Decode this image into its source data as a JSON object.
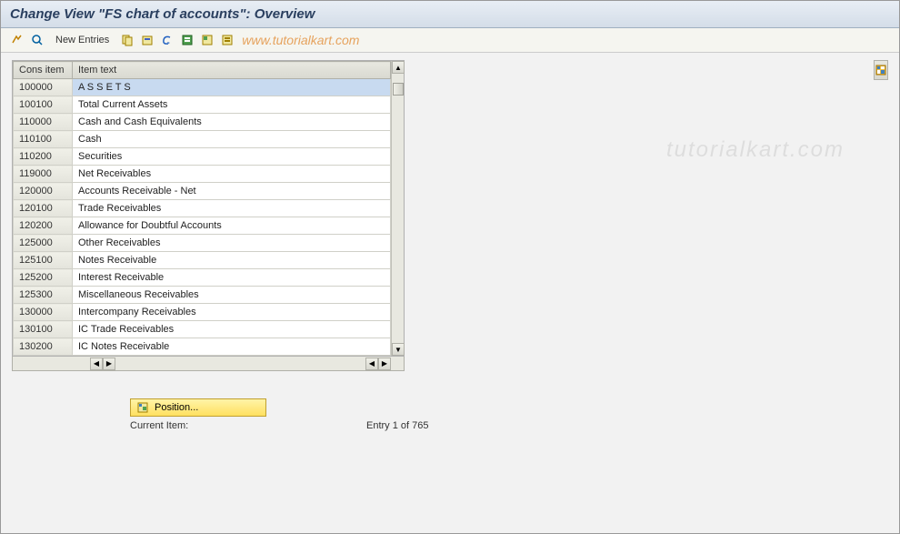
{
  "title": "Change View \"FS chart of accounts\": Overview",
  "watermark_text": "www.tutorialkart.com",
  "watermark_side": "tutorialkart.com",
  "toolbar": {
    "new_entries": "New Entries"
  },
  "table": {
    "headers": {
      "cons_item": "Cons item",
      "item_text": "Item text"
    },
    "rows": [
      {
        "cons": "100000",
        "text": "A S S E T S"
      },
      {
        "cons": "100100",
        "text": "Total Current Assets"
      },
      {
        "cons": "110000",
        "text": "Cash and Cash Equivalents"
      },
      {
        "cons": "110100",
        "text": "Cash"
      },
      {
        "cons": "110200",
        "text": "Securities"
      },
      {
        "cons": "119000",
        "text": "Net Receivables"
      },
      {
        "cons": "120000",
        "text": "Accounts Receivable - Net"
      },
      {
        "cons": "120100",
        "text": "Trade Receivables"
      },
      {
        "cons": "120200",
        "text": "Allowance for Doubtful Accounts"
      },
      {
        "cons": "125000",
        "text": "Other Receivables"
      },
      {
        "cons": "125100",
        "text": "Notes Receivable"
      },
      {
        "cons": "125200",
        "text": "Interest Receivable"
      },
      {
        "cons": "125300",
        "text": "Miscellaneous Receivables"
      },
      {
        "cons": "130000",
        "text": "Intercompany Receivables"
      },
      {
        "cons": "130100",
        "text": "IC Trade Receivables"
      },
      {
        "cons": "130200",
        "text": "IC Notes Receivable"
      }
    ]
  },
  "footer": {
    "position_label": "Position...",
    "current_item_label": "Current Item:",
    "entry_text": "Entry 1 of 765"
  }
}
